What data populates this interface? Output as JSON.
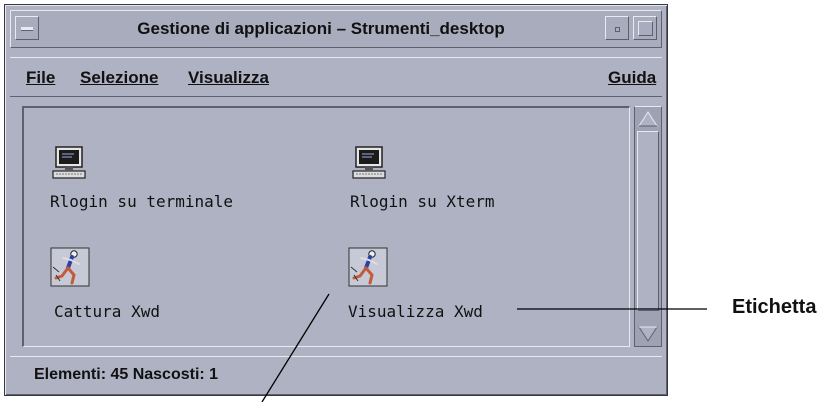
{
  "window": {
    "title": "Gestione di applicazioni – Strumenti_desktop"
  },
  "menubar": {
    "items": [
      {
        "label": "File"
      },
      {
        "label": "Selezione"
      },
      {
        "label": "Visualizza"
      }
    ],
    "help": {
      "label": "Guida"
    }
  },
  "content": {
    "items": [
      {
        "label": "Rlogin su terminale",
        "icon": "terminal-computer-icon"
      },
      {
        "label": "Rlogin su Xterm",
        "icon": "terminal-computer-icon"
      },
      {
        "label": "Cattura Xwd",
        "icon": "running-figure-icon"
      },
      {
        "label": "Visualizza Xwd",
        "icon": "running-figure-icon"
      }
    ]
  },
  "status": {
    "text": "Elementi: 45  Nascosti: 1"
  },
  "annotation": {
    "label": "Etichetta"
  },
  "colors": {
    "window_bg": "#aeb2c3",
    "scrollbar_bg": "#9ea2b3",
    "text": "#111111"
  }
}
